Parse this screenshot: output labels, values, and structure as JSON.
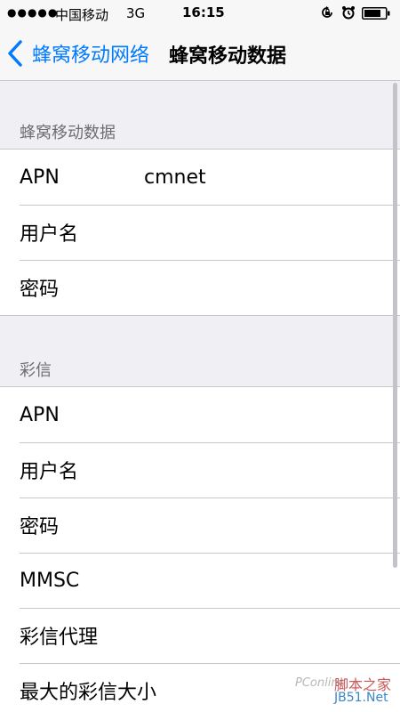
{
  "status_bar": {
    "signal": "●●●●●",
    "carrier": "中国移动",
    "network": "3G",
    "time": "16:15",
    "icons": [
      "rotation-lock-icon",
      "alarm-icon",
      "battery-icon"
    ]
  },
  "nav": {
    "back_label": "蜂窝移动网络",
    "title": "蜂窝移动数据",
    "accent_color": "#007aff"
  },
  "sections": [
    {
      "header": "蜂窝移动数据",
      "rows": [
        {
          "label": "APN",
          "value": "cmnet"
        },
        {
          "label": "用户名",
          "value": ""
        },
        {
          "label": "密码",
          "value": ""
        }
      ]
    },
    {
      "header": "彩信",
      "rows": [
        {
          "label": "APN",
          "value": ""
        },
        {
          "label": "用户名",
          "value": ""
        },
        {
          "label": "密码",
          "value": ""
        },
        {
          "label": "MMSC",
          "value": ""
        },
        {
          "label": "彩信代理",
          "value": ""
        },
        {
          "label": "最大的彩信大小",
          "value": ""
        }
      ]
    }
  ],
  "watermark": {
    "left": "PConline",
    "cn": "脚本之家",
    "site": "JB51.Net"
  }
}
